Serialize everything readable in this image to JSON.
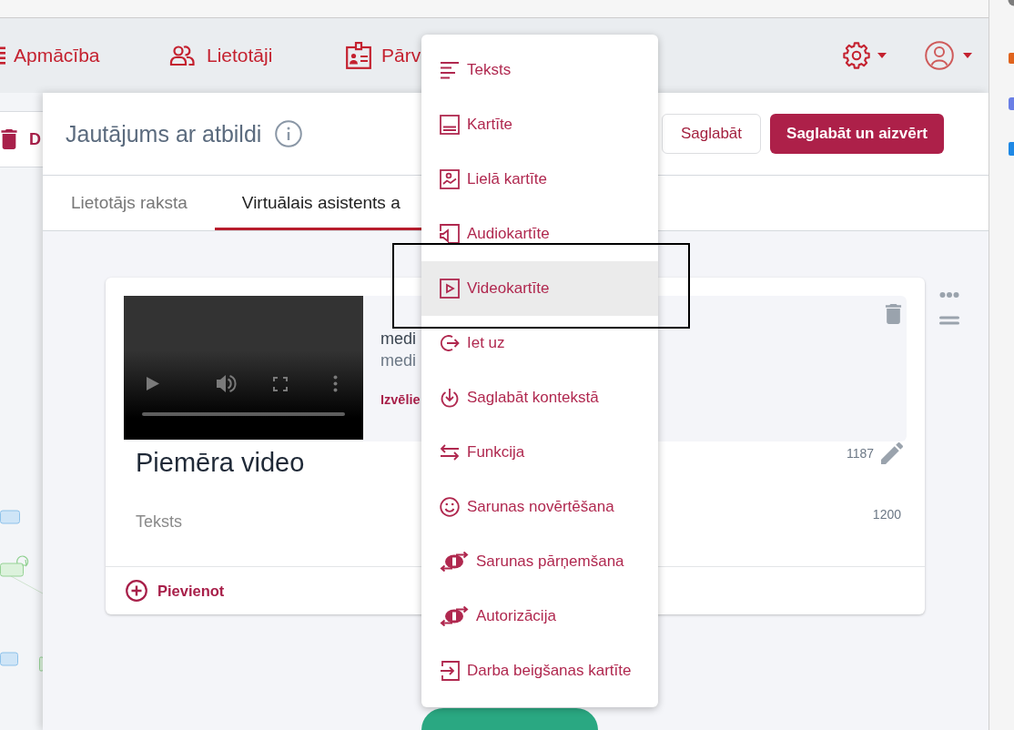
{
  "nav": {
    "items": [
      {
        "label": "Apmācība"
      },
      {
        "label": "Lietotāji"
      },
      {
        "label": "Pārv"
      }
    ]
  },
  "left_toolbar": {
    "button": "D"
  },
  "dialog": {
    "title": "Jautājums ar atbildi",
    "buttons": [
      {
        "label": "Saglabāt",
        "kind": "secondary"
      },
      {
        "label": "Saglabāt un aizvērt",
        "kind": "primary"
      }
    ],
    "tabs": [
      {
        "label": "Lietotājs raksta",
        "selected": false
      },
      {
        "label": "Virtuālais asistents a",
        "selected": true
      }
    ],
    "card": {
      "media": {
        "line_1": "medi",
        "line_2": "medi",
        "link": "Izvēlie"
      },
      "title": "Piemēra video",
      "title_counter": "1187",
      "text_field": {
        "placeholder": "Teksts",
        "counter": "1200"
      },
      "add_button": "Pievienot"
    }
  },
  "menu": {
    "items": [
      {
        "label": "Teksts",
        "selected": false
      },
      {
        "label": "Kartīte",
        "selected": false
      },
      {
        "label": "Lielā kartīte",
        "selected": false
      },
      {
        "label": "Audiokartīte",
        "selected": false
      },
      {
        "label": "Videokartīte",
        "selected": true
      },
      {
        "label": "Iet uz",
        "selected": false
      },
      {
        "label": "Saglabāt kontekstā",
        "selected": false
      },
      {
        "label": "Funkcija",
        "selected": false
      },
      {
        "label": "Sarunas novērtēšana",
        "selected": false
      },
      {
        "label": "Sarunas pārņemšana",
        "selected": false
      },
      {
        "label": "Autorizācija",
        "selected": false
      },
      {
        "label": "Darba beigšanas kartīte",
        "selected": false
      }
    ]
  }
}
